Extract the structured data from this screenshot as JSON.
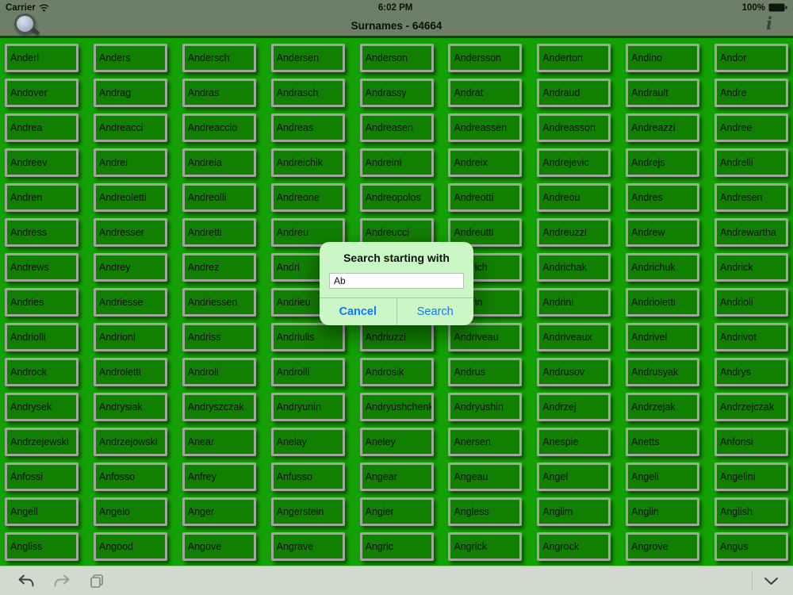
{
  "status_bar": {
    "carrier": "Carrier",
    "time": "6:02 PM",
    "battery": "100%"
  },
  "nav_bar": {
    "title": "Surnames - 64664"
  },
  "grid": {
    "rows": [
      [
        "Anderl",
        "Anders",
        "Andersch",
        "Andersen",
        "Anderson",
        "Andersson",
        "Anderton",
        "Andino",
        "Andor"
      ],
      [
        "Andover",
        "Andrag",
        "Andras",
        "Andrasch",
        "Andrassy",
        "Andrat",
        "Andraud",
        "Andrault",
        "Andre"
      ],
      [
        "Andrea",
        "Andreacci",
        "Andreaccio",
        "Andreas",
        "Andreasen",
        "Andreassen",
        "Andreasson",
        "Andreazzi",
        "Andree"
      ],
      [
        "Andreev",
        "Andrei",
        "Andreia",
        "Andreichik",
        "Andreini",
        "Andreix",
        "Andrejevic",
        "Andrejs",
        "Andrelli"
      ],
      [
        "Andren",
        "Andreoletti",
        "Andreolli",
        "Andreone",
        "Andreopolos",
        "Andreotti",
        "Andreou",
        "Andres",
        "Andresen"
      ],
      [
        "Andress",
        "Andresser",
        "Andretti",
        "Andreu",
        "Andreucci",
        "Andreutti",
        "Andreuzzi",
        "Andrew",
        "Andrewartha"
      ],
      [
        "Andrews",
        "Andrey",
        "Andrez",
        "Andri",
        "",
        "Andrich",
        "Andrichak",
        "Andrichuk",
        "Andrick"
      ],
      [
        "Andries",
        "Andriesse",
        "Andriessen",
        "Andrieu",
        "",
        "Andrin",
        "Andrini",
        "Andrioletti",
        "Andrioli"
      ],
      [
        "Andriolli",
        "Andrioni",
        "Andriss",
        "Andriulis",
        "Andriuzzi",
        "Andriveau",
        "Andriveaux",
        "Andrivel",
        "Andrivot"
      ],
      [
        "Androck",
        "Androletti",
        "Androli",
        "Androlli",
        "Androsik",
        "Andrus",
        "Andrusov",
        "Andrusyak",
        "Andrys"
      ],
      [
        "Andrysek",
        "Andrysiak",
        "Andryszczak",
        "Andryunin",
        "Andryushchenko",
        "Andryushin",
        "Andrzej",
        "Andrzejak",
        "Andrzejczak"
      ],
      [
        "Andrzejewski",
        "Andrzejowski",
        "Anear",
        "Anelay",
        "Aneley",
        "Anersen",
        "Anespie",
        "Anetts",
        "Anfonsi"
      ],
      [
        "Anfossi",
        "Anfosso",
        "Anfrey",
        "Anfusso",
        "Angear",
        "Angeau",
        "Angel",
        "Angeli",
        "Angelini"
      ],
      [
        "Angell",
        "Angelo",
        "Anger",
        "Angerstein",
        "Angier",
        "Angless",
        "Anglim",
        "Anglin",
        "Anglish"
      ],
      [
        "Angliss",
        "Angood",
        "Angove",
        "Angrave",
        "Angric",
        "Angrick",
        "Angrock",
        "Angrove",
        "Angus"
      ]
    ]
  },
  "dialog": {
    "title": "Search starting with",
    "input_value": "Ab",
    "cancel_label": "Cancel",
    "search_label": "Search"
  },
  "colors": {
    "accent_blue": "#0a7aff",
    "grid_background_green": "#13a004",
    "button_green": "#117f02",
    "dialog_pale_green": "#cbf6c5",
    "header_gray_green": "#6d7f68",
    "toolbar_gray": "#d4d9d0"
  }
}
